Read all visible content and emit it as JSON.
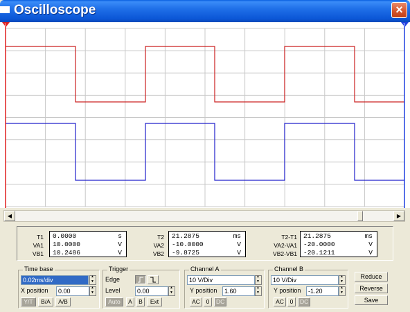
{
  "window": {
    "title": "Oscilloscope",
    "close_glyph": "×"
  },
  "cursors": {
    "t1_label": "1",
    "t2_label": "2",
    "t1_color": "#e02020",
    "t2_color": "#2040e0"
  },
  "traces": {
    "channel_a_color": "#cc2020",
    "channel_b_color": "#2020cc"
  },
  "measurements": {
    "t1": {
      "labels": [
        "T1",
        "VA1",
        "VB1"
      ],
      "values": [
        "0.0000",
        "10.0000",
        "10.2486"
      ],
      "units": [
        "s",
        "V",
        "V"
      ]
    },
    "t2": {
      "labels": [
        "T2",
        "VA2",
        "VB2"
      ],
      "values": [
        "21.2875",
        "-10.0000",
        "-9.8725"
      ],
      "units": [
        "ms",
        "V",
        "V"
      ]
    },
    "diff": {
      "labels": [
        "T2-T1",
        "VA2-VA1",
        "VB2-VB1"
      ],
      "values": [
        "21.2875",
        "-20.0000",
        "-20.1211"
      ],
      "units": [
        "ms",
        "V",
        "V"
      ]
    }
  },
  "timebase": {
    "title": "Time base",
    "scale": "0.02ms/div",
    "xpos_label": "X position",
    "xpos": "0.00",
    "modes": [
      "Y/T",
      "B/A",
      "A/B"
    ]
  },
  "trigger": {
    "title": "Trigger",
    "edge_label": "Edge",
    "level_label": "Level",
    "level": "0.00",
    "buttons": [
      "Auto",
      "A",
      "B",
      "Ext"
    ]
  },
  "channel_a": {
    "title": "Channel A",
    "scale": "10 V/Div",
    "ypos_label": "Y position",
    "ypos": "1.60",
    "coupling": [
      "AC",
      "0",
      "DC"
    ]
  },
  "channel_b": {
    "title": "Channel B",
    "scale": "10 V/Div",
    "ypos_label": "Y position",
    "ypos": "-1.20",
    "coupling": [
      "AC",
      "0",
      "DC"
    ]
  },
  "actions": {
    "reduce": "Reduce",
    "reverse": "Reverse",
    "save": "Save"
  }
}
